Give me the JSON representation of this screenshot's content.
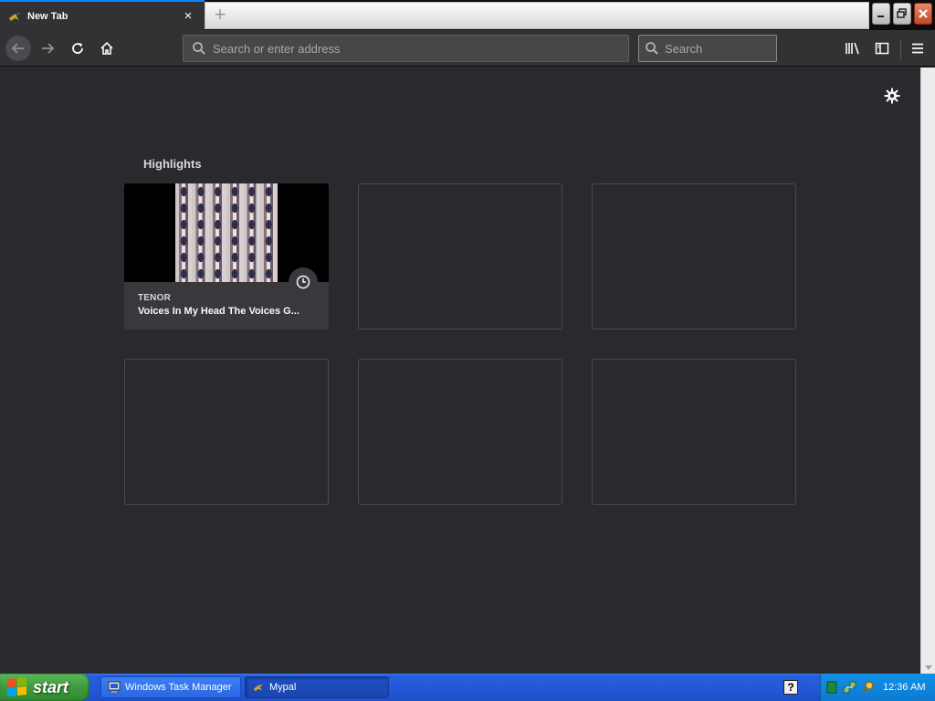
{
  "browser": {
    "tab": {
      "title": "New Tab",
      "close_glyph": "×"
    },
    "new_tab_glyph": "+",
    "url_placeholder": "Search or enter address",
    "search_placeholder": "Search"
  },
  "content": {
    "section_title": "Highlights",
    "cards": [
      {
        "source": "TENOR",
        "title": "Voices In My Head The Voices G..."
      }
    ]
  },
  "taskbar": {
    "start_label": "start",
    "tasks": [
      {
        "label": "Windows Task Manager"
      },
      {
        "label": "Mypal"
      }
    ],
    "help_glyph": "?",
    "clock": "12:36 AM"
  },
  "colors": {
    "accent": "#0a84ff",
    "background": "#2a2a2e",
    "toolbar": "#323234"
  }
}
